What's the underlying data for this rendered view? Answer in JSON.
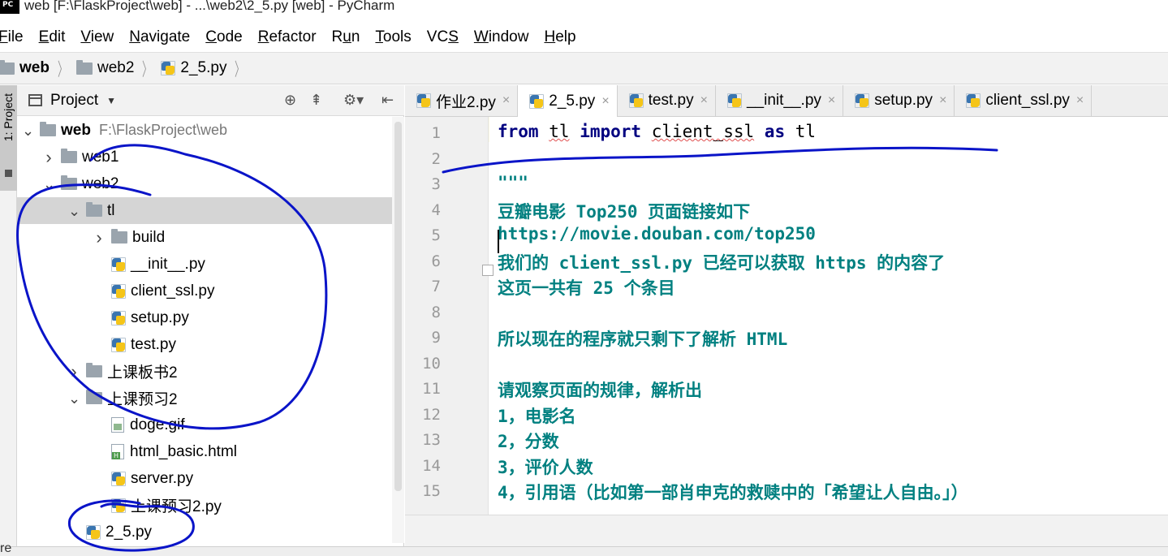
{
  "window": {
    "title": "web [F:\\FlaskProject\\web] - ...\\web2\\2_5.py [web] - PyCharm",
    "app_icon": "pycharm-icon"
  },
  "menu": [
    {
      "prefix": "",
      "underline": "F",
      "rest": "ile"
    },
    {
      "prefix": "",
      "underline": "E",
      "rest": "dit"
    },
    {
      "prefix": "",
      "underline": "V",
      "rest": "iew"
    },
    {
      "prefix": "",
      "underline": "N",
      "rest": "avigate"
    },
    {
      "prefix": "",
      "underline": "C",
      "rest": "ode"
    },
    {
      "prefix": "",
      "underline": "R",
      "rest": "efactor"
    },
    {
      "prefix": "R",
      "underline": "u",
      "rest": "n"
    },
    {
      "prefix": "",
      "underline": "T",
      "rest": "ools"
    },
    {
      "prefix": "VC",
      "underline": "S",
      "rest": ""
    },
    {
      "prefix": "",
      "underline": "W",
      "rest": "indow"
    },
    {
      "prefix": "",
      "underline": "H",
      "rest": "elp"
    }
  ],
  "breadcrumb": {
    "root": "web",
    "folder": "web2",
    "file": "2_5.py"
  },
  "toolstrip": {
    "project_tab": "1: Project",
    "bottom_label": "re"
  },
  "project_panel": {
    "title": "Project",
    "tools": [
      "locate-icon",
      "collapse-icon",
      "gear-icon",
      "hide-icon"
    ],
    "tree": [
      {
        "name": "web",
        "path": "F:\\FlaskProject\\web",
        "level": 0,
        "type": "folder",
        "expanded": true,
        "bold": true
      },
      {
        "name": "web1",
        "level": 1,
        "type": "folder",
        "expanded": false
      },
      {
        "name": "web2",
        "level": 1,
        "type": "folder",
        "expanded": true
      },
      {
        "name": "tl",
        "level": 2,
        "type": "folder",
        "expanded": true,
        "selected": true
      },
      {
        "name": "build",
        "level": 3,
        "type": "folder",
        "expanded": false
      },
      {
        "name": "__init__.py",
        "level": 3,
        "type": "py"
      },
      {
        "name": "client_ssl.py",
        "level": 3,
        "type": "py"
      },
      {
        "name": "setup.py",
        "level": 3,
        "type": "py"
      },
      {
        "name": "test.py",
        "level": 3,
        "type": "py"
      },
      {
        "name": "上课板书2",
        "level": 2,
        "type": "folder",
        "expanded": false
      },
      {
        "name": "上课预习2",
        "level": 2,
        "type": "folder",
        "expanded": true
      },
      {
        "name": "doge.gif",
        "level": 3,
        "type": "img"
      },
      {
        "name": "html_basic.html",
        "level": 3,
        "type": "html"
      },
      {
        "name": "server.py",
        "level": 3,
        "type": "py"
      },
      {
        "name": "上课预习2.py",
        "level": 3,
        "type": "py"
      },
      {
        "name": "2_5.py",
        "level": 2,
        "type": "py"
      }
    ]
  },
  "editor": {
    "tabs": [
      {
        "label": "作业2.py",
        "active": false
      },
      {
        "label": "2_5.py",
        "active": true
      },
      {
        "label": "test.py",
        "active": false
      },
      {
        "label": "__init__.py",
        "active": false
      },
      {
        "label": "setup.py",
        "active": false
      },
      {
        "label": "client_ssl.py",
        "active": false
      }
    ],
    "close_glyph": "×",
    "lines": [
      {
        "n": "1",
        "kind": "import",
        "kw1": "from",
        "mod": "tl",
        "kw2": "import",
        "name": "client_ssl",
        "kw3": "as",
        "alias": "tl"
      },
      {
        "n": "2",
        "kind": "blank",
        "text": ""
      },
      {
        "n": "3",
        "kind": "doc",
        "text": "\"\"\""
      },
      {
        "n": "4",
        "kind": "doc",
        "text": "豆瓣电影 Top250 页面链接如下"
      },
      {
        "n": "5",
        "kind": "doc",
        "text": "https://movie.douban.com/top250"
      },
      {
        "n": "6",
        "kind": "doc",
        "text": "我们的 client_ssl.py 已经可以获取 https 的内容了"
      },
      {
        "n": "7",
        "kind": "doc",
        "text": "这页一共有 25 个条目"
      },
      {
        "n": "8",
        "kind": "doc",
        "text": ""
      },
      {
        "n": "9",
        "kind": "doc",
        "text": "所以现在的程序就只剩下了解析 HTML"
      },
      {
        "n": "10",
        "kind": "doc",
        "text": ""
      },
      {
        "n": "11",
        "kind": "doc",
        "text": "请观察页面的规律，解析出"
      },
      {
        "n": "12",
        "kind": "doc",
        "text": "1，电影名"
      },
      {
        "n": "13",
        "kind": "doc",
        "text": "2，分数"
      },
      {
        "n": "14",
        "kind": "doc",
        "text": "3，评价人数"
      },
      {
        "n": "15",
        "kind": "doc",
        "text": "4，引用语（比如第一部肖申克的救赎中的「希望让人自由。」）"
      }
    ]
  },
  "colors": {
    "keyword": "#000080",
    "docstring": "#008080",
    "annotation_ink": "#0a14c8",
    "selection": "#d5d5d5",
    "current_line": "#fcfae6"
  }
}
